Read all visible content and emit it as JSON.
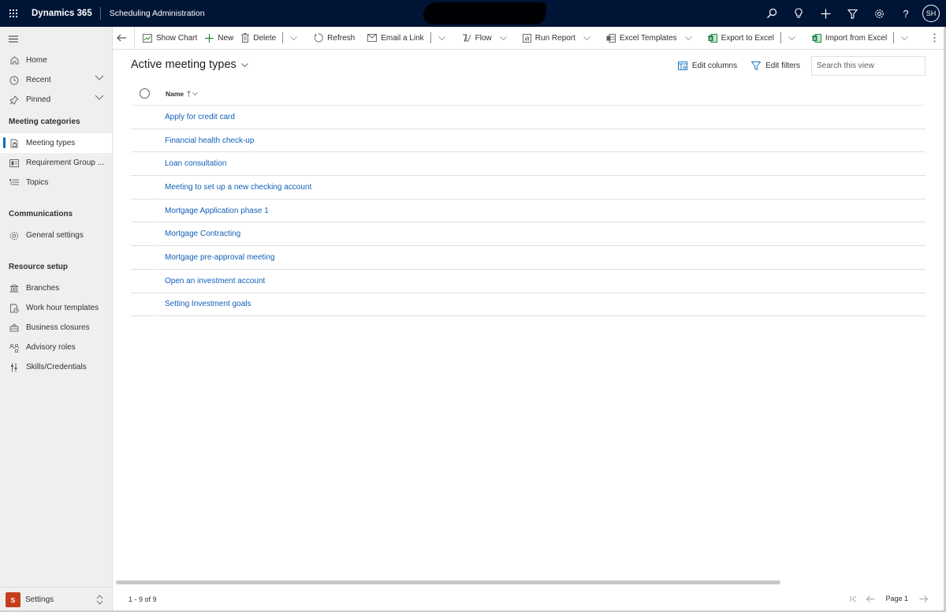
{
  "topbar": {
    "brand": "Dynamics 365",
    "app_name": "Scheduling Administration",
    "redacted": true,
    "icons": [
      "search-icon",
      "lightbulb-icon",
      "plus-icon",
      "filter-icon",
      "gear-icon",
      "help-icon"
    ],
    "user_initials": "SH"
  },
  "sidebar": {
    "top_items": [
      {
        "label": "Home",
        "icon": "home-icon"
      },
      {
        "label": "Recent",
        "icon": "clock-icon",
        "expandable": true
      },
      {
        "label": "Pinned",
        "icon": "pin-icon",
        "expandable": true
      }
    ],
    "groups": [
      {
        "title": "Meeting categories",
        "items": [
          {
            "label": "Meeting types",
            "icon": "meeting-type-icon",
            "active": true
          },
          {
            "label": "Requirement Group ...",
            "icon": "requirement-group-icon"
          },
          {
            "label": "Topics",
            "icon": "topics-icon"
          }
        ]
      },
      {
        "title": "Communications",
        "items": [
          {
            "label": "General settings",
            "icon": "gear-icon"
          }
        ]
      },
      {
        "title": "Resource setup",
        "items": [
          {
            "label": "Branches",
            "icon": "bank-icon"
          },
          {
            "label": "Work hour templates",
            "icon": "work-hours-icon"
          },
          {
            "label": "Business closures",
            "icon": "closure-icon"
          },
          {
            "label": "Advisory roles",
            "icon": "roles-icon"
          },
          {
            "label": "Skills/Credentials",
            "icon": "skills-icon"
          }
        ]
      }
    ],
    "area": {
      "badge": "S",
      "label": "Settings",
      "badge_color": "#c43e1c"
    }
  },
  "commandbar": {
    "show_chart": "Show Chart",
    "new": "New",
    "delete": "Delete",
    "refresh": "Refresh",
    "email_link": "Email a Link",
    "flow": "Flow",
    "run_report": "Run Report",
    "excel_templates": "Excel Templates",
    "export_excel": "Export to Excel",
    "import_excel": "Import from Excel"
  },
  "view": {
    "title": "Active meeting types",
    "edit_columns": "Edit columns",
    "edit_filters": "Edit filters",
    "search_placeholder": "Search this view",
    "search_value": ""
  },
  "grid": {
    "columns": [
      {
        "label": "Name",
        "sort": "ascending"
      }
    ],
    "rows": [
      "Apply for credit card",
      "Financial health check-up",
      "Loan consultation",
      "Meeting to set up a new checking account",
      "Mortgage Application phase 1",
      "Mortgage Contracting",
      "Mortgage pre-approval meeting",
      "Open an investment account",
      "Setting Investment goals"
    ]
  },
  "footer": {
    "record_count": "1 - 9 of 9",
    "page_label": "Page 1"
  },
  "colors": {
    "topbar_bg": "#001435",
    "link": "#1160b7",
    "accent": "#0f6cbd",
    "excel_green": "#107c41",
    "new_green": "#107c10"
  }
}
